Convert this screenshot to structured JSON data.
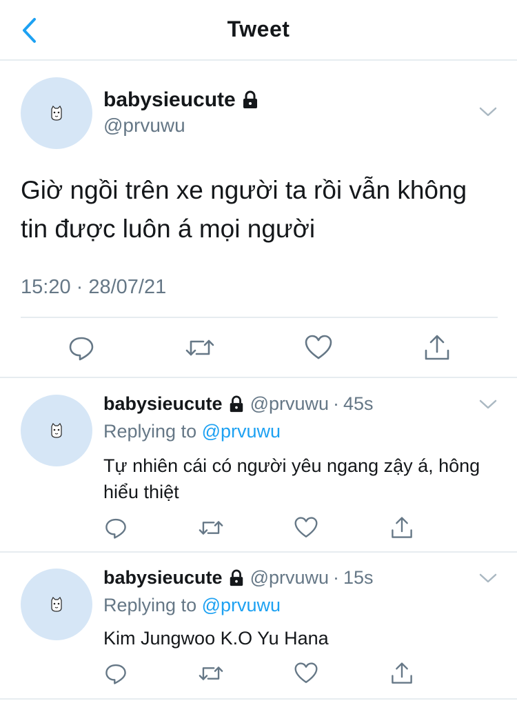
{
  "header": {
    "title": "Tweet"
  },
  "main_tweet": {
    "display_name": "babysieucute",
    "handle": "@prvuwu",
    "text": "Giờ ngồi trên xe người ta rồi vẫn không tin được luôn á mọi người",
    "timestamp": "15:20 · 28/07/21"
  },
  "replies": [
    {
      "display_name": "babysieucute",
      "handle": "@prvuwu",
      "separator": "·",
      "time": "45s",
      "replying_prefix": "Replying to",
      "replying_to": "@prvuwu",
      "text": "Tự nhiên cái có người yêu ngang zậy á, hông hiểu thiệt"
    },
    {
      "display_name": "babysieucute",
      "handle": "@prvuwu",
      "separator": "·",
      "time": "15s",
      "replying_prefix": "Replying to",
      "replying_to": "@prvuwu",
      "text": "Kim Jungwoo K.O Yu Hana"
    }
  ],
  "colors": {
    "accent": "#1da1f2",
    "muted": "#657786",
    "avatar_bg": "#d6e6f6",
    "divider": "#e6ecf0",
    "text": "#14171a"
  },
  "icons": [
    "back-chevron-icon",
    "lock-icon",
    "chevron-down-icon",
    "reply-icon",
    "retweet-icon",
    "like-icon",
    "share-icon"
  ]
}
